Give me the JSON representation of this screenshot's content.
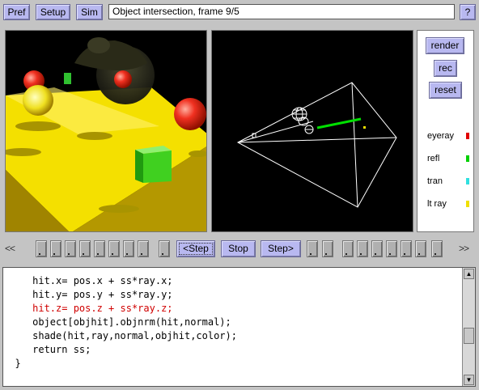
{
  "toolbar": {
    "pref_label": "Pref",
    "setup_label": "Setup",
    "sim_label": "Sim",
    "title_value": "Object intersection, frame 9/5",
    "help_label": "?"
  },
  "side_panel": {
    "render_label": "render",
    "rec_label": "rec",
    "reset_label": "reset",
    "legend": [
      {
        "label": "eyeray",
        "color": "#e00000"
      },
      {
        "label": "refl",
        "color": "#00d000"
      },
      {
        "label": "tran",
        "color": "#30e0e0"
      },
      {
        "label": "lt ray",
        "color": "#f0e000"
      }
    ]
  },
  "controls": {
    "rewind_label": "<<",
    "forward_label": ">>",
    "step_back_label": "<Step",
    "stop_label": "Stop",
    "step_label": "Step>"
  },
  "code": {
    "lines": [
      {
        "text": "     hit.x= pos.x + ss*ray.x;",
        "color": "#000000"
      },
      {
        "text": "     hit.y= pos.y + ss*ray.y;",
        "color": "#000000"
      },
      {
        "text": "     hit.z= pos.z + ss*ray.z;",
        "color": "#d00000"
      },
      {
        "text": "     object[objhit].objnrm(hit,normal);",
        "color": "#000000"
      },
      {
        "text": "     shade(hit,ray,normal,objhit,color);",
        "color": "#000000"
      },
      {
        "text": "     return ss;",
        "color": "#000000"
      },
      {
        "text": "  }",
        "color": "#000000"
      }
    ],
    "scroll_up_icon": "arrow-up-icon",
    "scroll_down_icon": "arrow-down-icon"
  }
}
